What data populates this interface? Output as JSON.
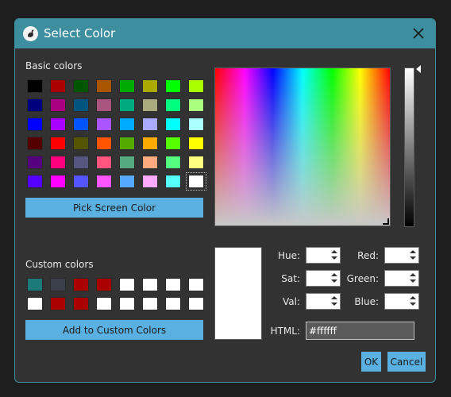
{
  "window": {
    "title": "Select Color",
    "app_icon": "swan-logo-icon",
    "close_icon": "close-icon"
  },
  "basic_colors": {
    "label": "Basic colors",
    "swatches": [
      "#000000",
      "#aa0000",
      "#005500",
      "#aa5500",
      "#00aa00",
      "#aaaa00",
      "#00ff00",
      "#aaff00",
      "#00007f",
      "#aa007f",
      "#00557f",
      "#aa557f",
      "#00aa7f",
      "#aaaa7f",
      "#00ff7f",
      "#aaff7f",
      "#0000ff",
      "#aa00ff",
      "#0055ff",
      "#aa55ff",
      "#00aaff",
      "#aaaaff",
      "#00ffff",
      "#aaffff",
      "#550000",
      "#ff0000",
      "#555500",
      "#ff5500",
      "#55aa00",
      "#ffaa00",
      "#55ff00",
      "#ffff00",
      "#55007f",
      "#ff007f",
      "#55557f",
      "#ff557f",
      "#55aa7f",
      "#ffaa7f",
      "#55ff7f",
      "#ffff7f",
      "#5500ff",
      "#ff00ff",
      "#5555ff",
      "#ff55ff",
      "#55aaff",
      "#ffaaff",
      "#55ffff",
      "#ffffff"
    ],
    "selected_index": 47
  },
  "pick_screen_label": "Pick Screen Color",
  "custom_colors": {
    "label": "Custom colors",
    "swatches": [
      "#1d7a7a",
      "#3a3f4a",
      "#aa0000",
      "#aa0000",
      "#ffffff",
      "#ffffff",
      "#ffffff",
      "#ffffff",
      "#ffffff",
      "#aa0000",
      "#aa0000",
      "#ffffff",
      "#ffffff",
      "#ffffff",
      "#ffffff",
      "#ffffff"
    ]
  },
  "add_custom_label": "Add to Custom Colors",
  "current_color": "#ffffff",
  "fields": {
    "hue": {
      "label": "Hue:",
      "value": ""
    },
    "sat": {
      "label": "Sat:",
      "value": ""
    },
    "val": {
      "label": "Val:",
      "value": ""
    },
    "red": {
      "label": "Red:",
      "value": ""
    },
    "green": {
      "label": "Green:",
      "value": ""
    },
    "blue": {
      "label": "Blue:",
      "value": ""
    }
  },
  "html_field": {
    "label": "HTML:",
    "value": "#ffffff"
  },
  "buttons": {
    "ok": "OK",
    "cancel": "Cancel"
  },
  "accent_color": "#3d8fa0",
  "button_color": "#5ab0e0"
}
